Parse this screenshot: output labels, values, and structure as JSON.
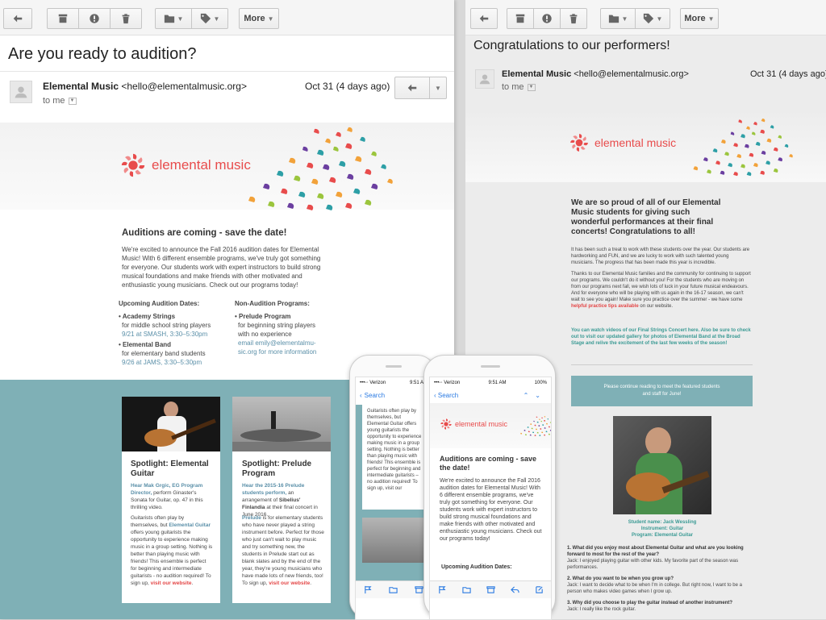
{
  "toolbar": {
    "more_label": "More"
  },
  "left": {
    "subject": "Are you ready to audition?",
    "sender_name": "Elemental Music",
    "sender_email": "<hello@elementalmusic.org>",
    "to": "to me",
    "date": "Oct 31 (4 days ago)",
    "logo_text": "elemental music",
    "heading": "Auditions are coming - save the date!",
    "intro": "We're excited to announce the Fall 2016 audition dates for Elemental Music! With 6 different ensemble programs, we've truly got something for everyone. Our students work with expert instructors to build strong musical foundations and make friends with other motivated and enthusiastic young musicians. Check out our programs today!",
    "col1_title": "Upcoming Audition Dates:",
    "col1_p1_name": "Academy Strings",
    "col1_p1_desc": "for middle school string players",
    "col1_p1_date": "9/21 at SMASH, 3:30–5:30pm",
    "col1_p2_name": "Elemental Band",
    "col1_p2_desc": "for elementary band students",
    "col1_p2_date": "9/26 at JAMS, 3:30–5:30pm",
    "col2_title": "Non-Audition Programs:",
    "col2_p1_name": "Prelude Program",
    "col2_p1_desc": "for beginning string players with no experience",
    "col2_email_prefix": "email ",
    "col2_email": "emily@elementalmu-sic.org",
    "col2_email_suffix": " for more information",
    "card1_title": "Spotlight: Elemental Guitar",
    "card1_lead": "Hear Mak Grgic, EG Program Director,",
    "card1_lead_rest": " perform Ginaster's Sonata for Guitar, op. 47 in this thrilling video.",
    "card1_body_a": "Guitarists often play by themselves, but ",
    "card1_body_b": "Elemental Guitar",
    "card1_body_c": " offers young guitarists the opportunity to experience making music in a group setting. Nothing is better than playing music with friends! This ensemble is perfect for beginning and intermediate guitarists - no audition required! To sign up, ",
    "card1_link": "visit our website",
    "card1_end": ".",
    "card2_title": "Spotlight: Prelude Program",
    "card2_lead": "Hear the 2015-16 Prelude students perform,",
    "card2_lead_rest_a": " an arrangement of ",
    "card2_lead_b": "Sibelius' Finlandia",
    "card2_lead_c": " at their final concert in June 2016.",
    "card2_body_a": "Prelude",
    "card2_body_b": " is for elementary students who have never played a string instrument before. Perfect for those who just can't wait to play music and try something new, the students in Prelude start out as blank slates and by the end of the year, they're young musicians who have made lots of new friends, too! To sign up, ",
    "card2_link": "visit our website",
    "card2_end": "."
  },
  "right": {
    "subject": "Congratulations to our performers!",
    "sender_name": "Elemental Music",
    "sender_email": "<hello@elementalmusic.org>",
    "to": "to me",
    "date": "Oct 31 (4 days ago)",
    "logo_text": "elemental music",
    "heading": "We are so proud of all of our Elemental Music students for giving such wonderful performances at their final concerts! Congratulations to all!",
    "p1": "It has been such a treat to work with these students over the year. Our students are hardworking and FUN, and we are lucky to work with such talented young musicians. The progress that has been made this year is incredible.",
    "p2a": "Thanks to our Elemental Music families and the community for continuing to support our programs. We couldn't do it without you! For the students who are moving on from our programs next fall, we wish lots of luck in your future musical endeavours. And for everyone who will be playing with us again in the 16-17 season, we can't wait to see you again! Make sure you practice over the summer - we have some ",
    "p2link": "helpful practice tips available",
    "p2b": " on our website.",
    "p3": "You can watch videos of our Final Strings Concert here. Also be sure to check out to visit our updated gallery for photos of Elemental Band at the Broad Stage and relive the excitement of the last few weeks of the season!",
    "banner": "Please continue reading to meet the featured students and staff for June!",
    "student_name": "Student name: Jack Wessling",
    "student_instrument": "Instrument: Guitar",
    "student_program": "Program: Elemental Guitar",
    "q1": "1. What did you enjoy most about Elemental Guitar and what are you looking forward to most for the rest of the year?",
    "a1": "Jack: I enjoyed playing guitar with other kids. My favorite part of the season was performances.",
    "q2": "2. What do you want to be when you grow up?",
    "a2": "Jack: I want to decide what to be when I'm in college. But right now, I want to be a person who makes video games when I grow up.",
    "q3": "3. Why did you choose to play the guitar instead of another instrument?",
    "a3": "Jack: I really like the rock guitar."
  },
  "phone_back": {
    "carrier": "•••◦◦ Verizon",
    "time": "9:51 AM",
    "back": "Search",
    "text": "Guitarists often play by themselves, but Elemental Guitar offers young guitarists the opportunity to experience making music in a group setting. Nothing is better than playing music with friends! This ensemble is perfect for beginning and intermediate guitarists – no audition required! To sign up, visit our"
  },
  "phone_front": {
    "carrier": "•••◦◦ Verizon",
    "time": "9:51 AM",
    "battery": "100%",
    "back": "Search",
    "logo_text": "elemental music",
    "heading": "Auditions are coming - save the date!",
    "text": "We're excited to announce the Fall 2016 audition dates for Elemental Music! With 6 different ensemble programs, we've truly got something for everyone. Our students work with expert instructors to build strong musical foundations and make friends with other motivated and enthusiastic young musicians. Check out our programs today!",
    "sub": "Upcoming Audition Dates:"
  }
}
